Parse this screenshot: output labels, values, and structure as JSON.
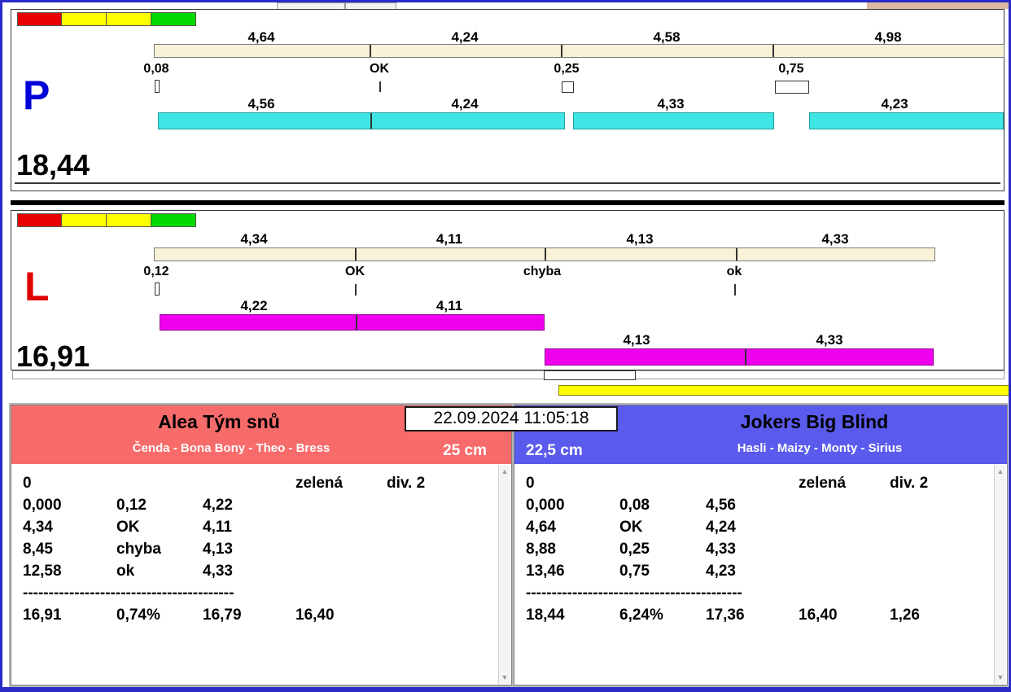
{
  "datetime": "22.09.2024 11:05:18",
  "lane_p": {
    "label": "P",
    "total": "18,44",
    "split_bar": [
      "4,64",
      "4,24",
      "4,58",
      "4,98"
    ],
    "markers": [
      "0,08",
      "OK",
      "0,25",
      "0,75"
    ],
    "dog_bar": [
      "4,56",
      "4,24",
      "4,33",
      "4,23"
    ]
  },
  "lane_l": {
    "label": "L",
    "total": "16,91",
    "split_bar": [
      "4,34",
      "4,11",
      "4,13",
      "4,33"
    ],
    "markers": [
      "0,12",
      "OK",
      "chyba",
      "ok"
    ],
    "dog_bar_1": [
      "4,22",
      "4,11"
    ],
    "dog_bar_2": [
      "4,13",
      "4,33"
    ]
  },
  "team_left": {
    "name": "Alea Tým snů",
    "members": "Čenda - Bona Bony - Theo - Bress",
    "jump_height": "25 cm",
    "table": {
      "rows": [
        [
          "0",
          "",
          "",
          "zelená",
          "div. 2"
        ],
        [
          "0,000",
          "0,12",
          "4,22",
          "",
          ""
        ],
        [
          "4,34",
          "OK",
          "4,11",
          "",
          ""
        ],
        [
          "8,45",
          "chyba",
          "4,13",
          "",
          ""
        ],
        [
          "12,58",
          "ok",
          "4,33",
          "",
          ""
        ]
      ],
      "separator": "-----------------------------------------",
      "totals": [
        "16,91",
        "0,74%",
        "16,79",
        "16,40",
        ""
      ]
    }
  },
  "team_right": {
    "name": "Jokers Big Blind",
    "members": "Hasli - Maizy - Monty - Sirius",
    "jump_height": "22,5 cm",
    "table": {
      "rows": [
        [
          "0",
          "",
          "",
          "zelená",
          "div. 2"
        ],
        [
          "0,000",
          "0,08",
          "4,56",
          "",
          ""
        ],
        [
          "4,64",
          "OK",
          "4,24",
          "",
          ""
        ],
        [
          "8,88",
          "0,25",
          "4,33",
          "",
          ""
        ],
        [
          "13,46",
          "0,75",
          "4,23",
          "",
          ""
        ]
      ],
      "separator": "------------------------------------------",
      "totals": [
        "18,44",
        "6,24%",
        "17,36",
        "16,40",
        "1,26"
      ]
    }
  },
  "colors": {
    "window_border": "#2a2ac8",
    "split_bar": "#f7f2d8",
    "lane_p_bar": "#40e6e6",
    "lane_l_bar": "#ee00ee",
    "caution_bar": "#ffff00",
    "team_left_header": "#f86b6b",
    "team_right_header": "#5a5aec",
    "lane_p_letter": "#0000d8",
    "lane_l_letter": "#e00000",
    "light_red": "#e80000",
    "light_yellow": "#ffff00",
    "light_green": "#00d800"
  }
}
